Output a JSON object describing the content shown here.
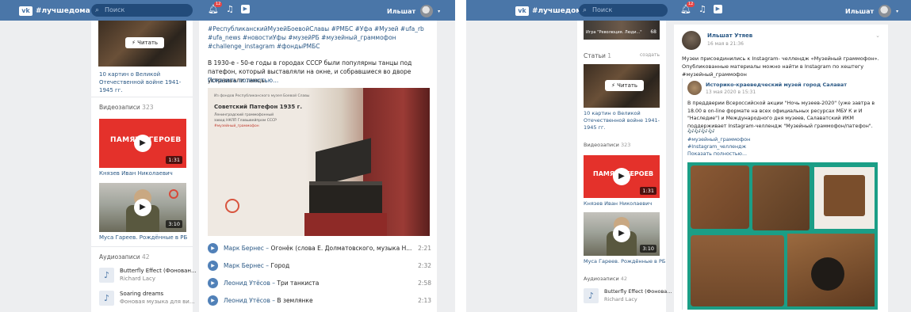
{
  "colors": {
    "accent": "#4a76a8",
    "link": "#2a5885",
    "bg": "#edeef0",
    "red": "#e4312b"
  },
  "header": {
    "brand": "#лучшедома",
    "search_placeholder": "Поиск",
    "notif_count": "12",
    "user_name": "Ильшат",
    "icons": [
      "vk-logo-icon",
      "search-icon",
      "bell-icon",
      "music-icon",
      "play-icon"
    ]
  },
  "left": {
    "article": {
      "read_button": "Читать",
      "title": "10 картин о Великой Отечественной войне 1941-1945 гг."
    },
    "videos": {
      "header": "Видеозаписи",
      "count": "323",
      "items": [
        {
          "overlay": "ПАМЯТЬ ГЕРОЕВ",
          "duration": "1:31",
          "title": "Князев Иван Николаевич"
        },
        {
          "duration": "3:10",
          "title": "Муса Гареев. Рождённые в РБ"
        }
      ]
    },
    "audios": {
      "header": "Аудиозаписи",
      "count": "42",
      "items": [
        {
          "title": "Butterfly Effect (Фонован...",
          "artist": "Richard Lacy"
        },
        {
          "title": "Soaring dreams",
          "artist": "Фоновая музыка для ви..."
        }
      ]
    },
    "post": {
      "tags": "#РеспубликанскийМузейБоевойСлавы #РМБС #Уфа #Музей #ufa_rb #ufa_news #новостиУфы #музейРБ #музейный_граммофон #challenge_instagram #фондыРМБС",
      "text": "В 1930-е - 50-е годы в городах СССР были популярны танцы под патефон, который выставляли на окне, и собравшиеся во дворе устраивали танцы.",
      "more": "Показать полностью...",
      "photo": {
        "caption": "Из фондов Республиканского музея Боевой Славы",
        "title": "Советский Патефон 1935 г.",
        "line1": "Ленинградский граммофонный",
        "line2": "завод НКЛП Главшвейпром СССР",
        "tag": "#музейный_граммофон"
      },
      "songs": [
        {
          "artist": "Марк Бернес",
          "title": "Огонёк (слова Е. Долматовского, музыка Н...",
          "duration": "2:21"
        },
        {
          "artist": "Марк Бернес",
          "title": "Город",
          "duration": "2:32"
        },
        {
          "artist": "Леонид Утёсов",
          "title": "Три танкиста",
          "duration": "2:58"
        },
        {
          "artist": "Леонид Утёсов",
          "title": "В землянке",
          "duration": "2:13"
        }
      ]
    }
  },
  "right": {
    "top_thumb_caption": "Игра \"Революция. Люди...\"",
    "top_thumb_count": "68",
    "articles": {
      "header": "Статьи",
      "count": "1",
      "action": "создать",
      "read_button": "Читать",
      "title": "10 картин о Великой Отечественной войне 1941-1945 гг."
    },
    "videos": {
      "header": "Видеозаписи",
      "count": "323",
      "items": [
        {
          "overlay": "ПАМЯТЬ ГЕРОЕВ",
          "duration": "1:31",
          "title": "Князев Иван Николаевич"
        },
        {
          "duration": "3:10",
          "title": "Муса Гареев. Рождённые в РБ"
        }
      ]
    },
    "audios": {
      "header": "Аудиозаписи",
      "count": "42",
      "items": [
        {
          "title": "Butterfly Effect (Фонова...",
          "artist": "Richard Lacy"
        }
      ]
    },
    "post": {
      "author": "Ильшат Утяев",
      "date": "16 мая в 21:36",
      "text": "Музеи присоединились к Instagram- челлендж «Музейный граммофон». Опубликованные материалы можно найти в Instagram по хештегу #музейный_граммофон",
      "repost_author": "Историко-краеведческий музей город Салават",
      "repost_date": "13 мая 2020 в 15:31",
      "repost_text": "В преддверии Всероссийской акции \"Ночь музеев-2020\" (уже завтра в 18.00 в on-line формате на всех официальных ресурсах МБУ К и И \"Наследие\") и Международного дня музеев, Салаватский ИКМ поддерживает Instagram-челлендж \"Музейный граммофон/патефон\".",
      "emoji": "🎶🎶🎶🎶",
      "tags": [
        "#музейный_граммофон",
        "#Instagram_челлендж"
      ],
      "more": "Показать полностью..."
    }
  }
}
